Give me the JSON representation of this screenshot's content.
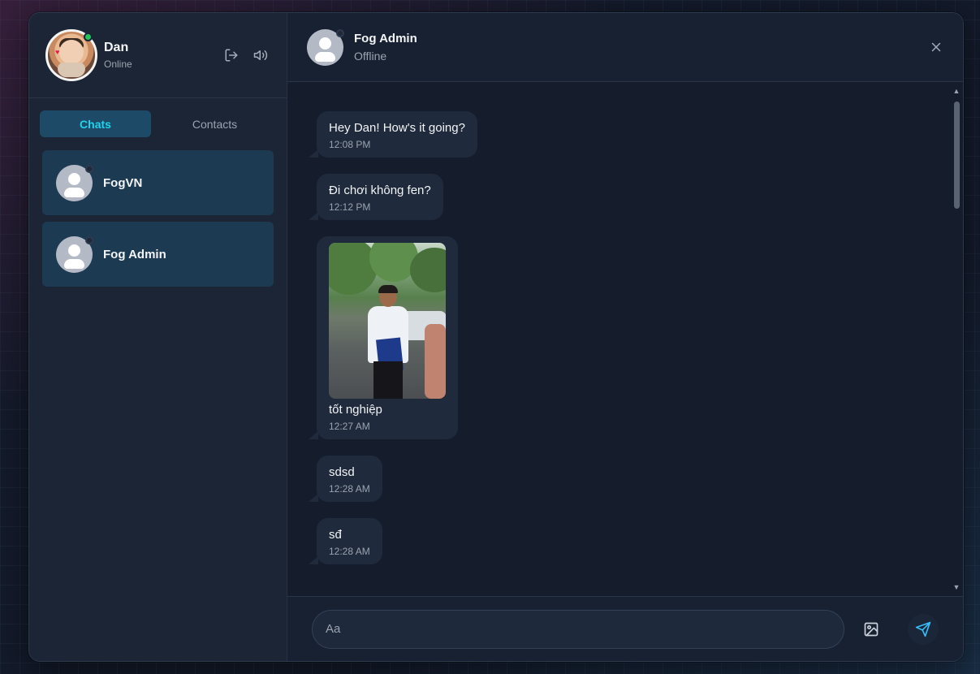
{
  "me": {
    "name": "Dan",
    "status": "Online"
  },
  "sidebar": {
    "tabs": [
      {
        "label": "Chats",
        "active": true
      },
      {
        "label": "Contacts",
        "active": false
      }
    ],
    "chats": [
      {
        "name": "FogVN"
      },
      {
        "name": "Fog Admin"
      }
    ]
  },
  "conversation": {
    "name": "Fog Admin",
    "status": "Offline",
    "messages": [
      {
        "text": "Hey Dan! How's it going?",
        "time": "12:08 PM"
      },
      {
        "text": "Đi chơi không fen?",
        "time": "12:12 PM"
      },
      {
        "text": "tốt nghiệp",
        "time": "12:27 AM",
        "has_image": true
      },
      {
        "text": "sdsd",
        "time": "12:28 AM"
      },
      {
        "text": "sđ",
        "time": "12:28 AM"
      }
    ]
  },
  "composer": {
    "placeholder": "Aa"
  },
  "colors": {
    "accent": "#22d3ee",
    "online": "#22c55e",
    "send": "#38bdf8"
  },
  "icons": [
    "logout-icon",
    "speaker-icon",
    "close-icon",
    "image-icon",
    "send-icon"
  ]
}
